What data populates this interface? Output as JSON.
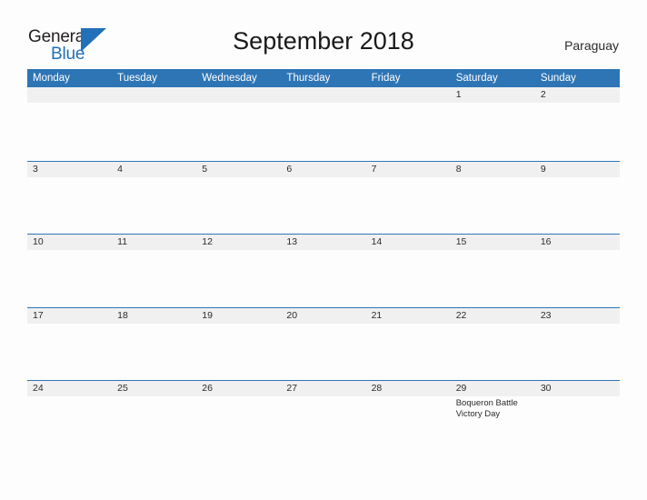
{
  "logo": {
    "word_one": "General",
    "word_two": "Blue",
    "flag_icon": "blue-triangle-flag-icon",
    "flag_color": "#2170b8"
  },
  "header": {
    "title": "September 2018",
    "country": "Paraguay"
  },
  "colors": {
    "header_blue": "#2e75b6",
    "date_band_gray": "#f0f0f0",
    "page_background": "#fdfdfd",
    "text_dark": "#2b2b2b",
    "weekday_text": "#ffffff"
  },
  "calendar": {
    "month": "September",
    "year": "2018",
    "weekday_headers": [
      "Monday",
      "Tuesday",
      "Wednesday",
      "Thursday",
      "Friday",
      "Saturday",
      "Sunday"
    ],
    "weeks": [
      {
        "days": [
          {
            "date": "",
            "events": []
          },
          {
            "date": "",
            "events": []
          },
          {
            "date": "",
            "events": []
          },
          {
            "date": "",
            "events": []
          },
          {
            "date": "",
            "events": []
          },
          {
            "date": "1",
            "events": []
          },
          {
            "date": "2",
            "events": []
          }
        ]
      },
      {
        "days": [
          {
            "date": "3",
            "events": []
          },
          {
            "date": "4",
            "events": []
          },
          {
            "date": "5",
            "events": []
          },
          {
            "date": "6",
            "events": []
          },
          {
            "date": "7",
            "events": []
          },
          {
            "date": "8",
            "events": []
          },
          {
            "date": "9",
            "events": []
          }
        ]
      },
      {
        "days": [
          {
            "date": "10",
            "events": []
          },
          {
            "date": "11",
            "events": []
          },
          {
            "date": "12",
            "events": []
          },
          {
            "date": "13",
            "events": []
          },
          {
            "date": "14",
            "events": []
          },
          {
            "date": "15",
            "events": []
          },
          {
            "date": "16",
            "events": []
          }
        ]
      },
      {
        "days": [
          {
            "date": "17",
            "events": []
          },
          {
            "date": "18",
            "events": []
          },
          {
            "date": "19",
            "events": []
          },
          {
            "date": "20",
            "events": []
          },
          {
            "date": "21",
            "events": []
          },
          {
            "date": "22",
            "events": []
          },
          {
            "date": "23",
            "events": []
          }
        ]
      },
      {
        "days": [
          {
            "date": "24",
            "events": []
          },
          {
            "date": "25",
            "events": []
          },
          {
            "date": "26",
            "events": []
          },
          {
            "date": "27",
            "events": []
          },
          {
            "date": "28",
            "events": []
          },
          {
            "date": "29",
            "events": [
              "Boqueron Battle Victory Day"
            ]
          },
          {
            "date": "30",
            "events": []
          }
        ]
      }
    ]
  }
}
